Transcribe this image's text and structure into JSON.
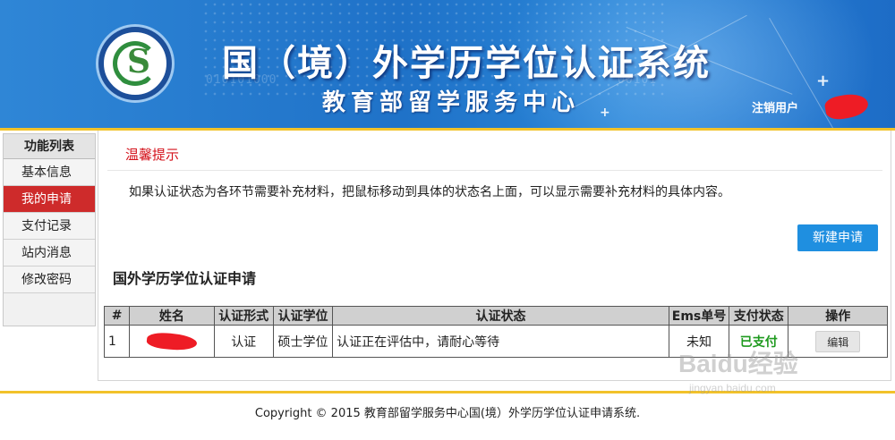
{
  "header": {
    "title": "国（境）外学历学位认证系统",
    "subtitle": "教育部留学服务中心",
    "logout": "注销用户",
    "binary_left": "010101000",
    "binary_right": "00101"
  },
  "sidebar": {
    "heading": "功能列表",
    "items": [
      {
        "label": "基本信息",
        "active": false
      },
      {
        "label": "我的申请",
        "active": true
      },
      {
        "label": "支付记录",
        "active": false
      },
      {
        "label": "站内消息",
        "active": false
      },
      {
        "label": "修改密码",
        "active": false
      }
    ]
  },
  "main": {
    "tip_title": "温馨提示",
    "tip_text": "如果认证状态为各环节需要补充材料，把鼠标移动到具体的状态名上面，可以显示需要补充材料的具体内容。",
    "new_button": "新建申请",
    "section_title": "国外学历学位认证申请",
    "table": {
      "headers": [
        "#",
        "姓名",
        "认证形式",
        "认证学位",
        "认证状态",
        "Ems单号",
        "支付状态",
        "操作"
      ],
      "rows": [
        {
          "index": "1",
          "name": "",
          "form": "认证",
          "degree": "硕士学位",
          "status": "认证正在评估中，请耐心等待",
          "ems": "未知",
          "pay_status": "已支付",
          "action": "编辑"
        }
      ]
    }
  },
  "footer": {
    "copyright": "Copyright © 2015 教育部留学服务中心国(境）外学历学位认证申请系统."
  },
  "watermark": {
    "main": "Baidu经验",
    "sub": "jingyan.baidu.com"
  },
  "colors": {
    "banner_blue": "#1f72c8",
    "accent_gold": "#f2c22a",
    "active_red": "#ce2b2b",
    "tip_red": "#d4121b",
    "button_blue": "#1f8fe0",
    "paid_green": "#1f9a1f"
  }
}
